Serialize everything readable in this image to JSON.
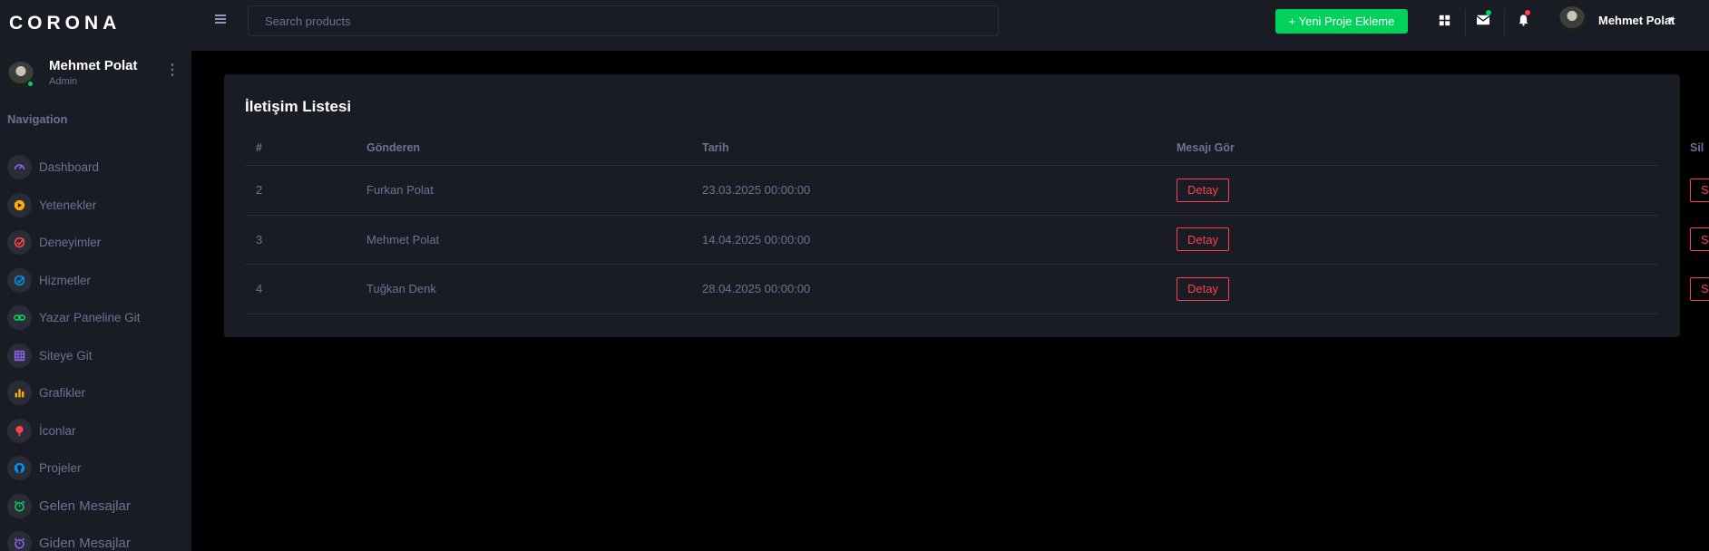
{
  "app": {
    "brand": "CORONA"
  },
  "profile": {
    "name": "Mehmet Polat",
    "role": "Admin"
  },
  "sidebar": {
    "heading": "Navigation",
    "items": [
      {
        "label": "Dashboard",
        "icon": "speedometer-icon",
        "color": "#8f5fe8"
      },
      {
        "label": "Yetenekler",
        "icon": "play-circle-icon",
        "color": "#ffab00"
      },
      {
        "label": "Deneyimler",
        "icon": "check-circle-icon",
        "color": "#fc424a"
      },
      {
        "label": "Hizmetler",
        "icon": "check-circle-icon",
        "color": "#0090e7"
      },
      {
        "label": "Yazar Paneline Git",
        "icon": "link-icon",
        "color": "#00d25b"
      },
      {
        "label": "Siteye Git",
        "icon": "table-icon",
        "color": "#8f5fe8"
      },
      {
        "label": "Grafikler",
        "icon": "bar-chart-icon",
        "color": "#ffab00"
      },
      {
        "label": "İconlar",
        "icon": "map-pin-icon",
        "color": "#fc424a"
      },
      {
        "label": "Projeler",
        "icon": "github-icon",
        "color": "#0090e7"
      },
      {
        "label": "Gelen Mesajlar",
        "icon": "alarm-clock-icon",
        "color": "#00d25b"
      },
      {
        "label": "Giden Mesajlar",
        "icon": "alarm-clock-icon",
        "color": "#8f5fe8"
      }
    ]
  },
  "topbar": {
    "search_placeholder": "Search products",
    "new_project_label": "+ Yeni Proje Ekleme",
    "user_name": "Mehmet Polat"
  },
  "card": {
    "title": "İletişim Listesi",
    "columns": [
      "#",
      "Gönderen",
      "Tarih",
      "Mesajı Gör",
      "Sil"
    ],
    "rows": [
      {
        "id": "2",
        "sender": "Furkan Polat",
        "date": "23.03.2025 00:00:00",
        "detail": "Detay",
        "delete": "Sil"
      },
      {
        "id": "3",
        "sender": "Mehmet Polat",
        "date": "14.04.2025 00:00:00",
        "detail": "Detay",
        "delete": "Sil"
      },
      {
        "id": "4",
        "sender": "Tuğkan Denk",
        "date": "28.04.2025 00:00:00",
        "detail": "Detay",
        "delete": "Sil"
      }
    ]
  },
  "colors": {
    "background": "#000000",
    "panel": "#191c24",
    "muted_text": "#6c7293",
    "success": "#00d25b",
    "danger": "#fc424a"
  }
}
